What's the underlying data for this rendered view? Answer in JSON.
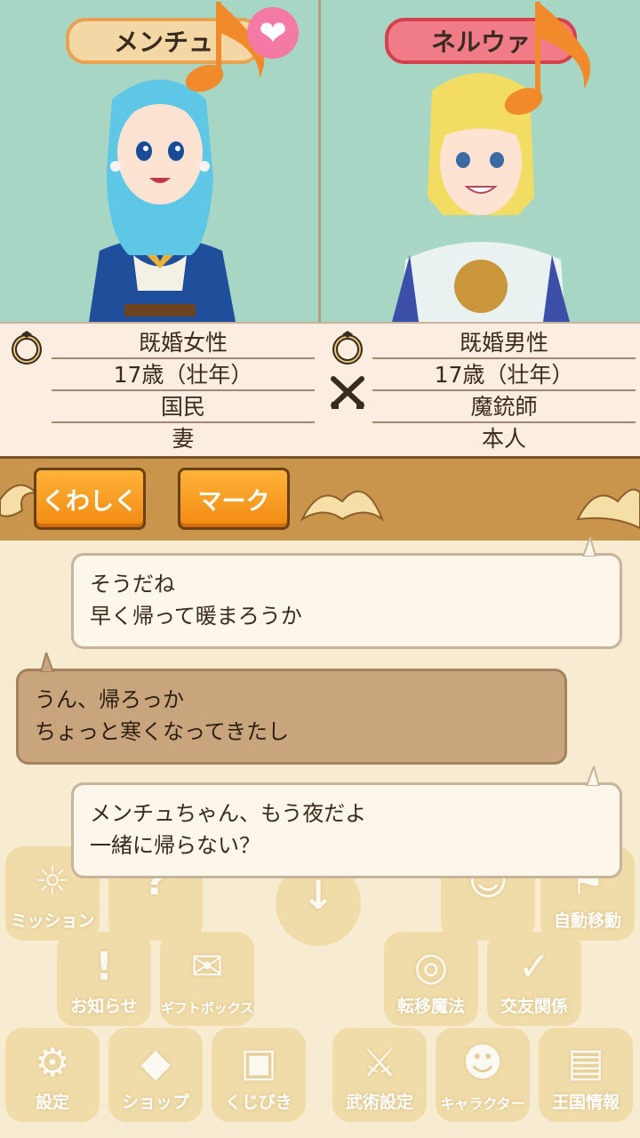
{
  "left_character": {
    "name": "メンチュ",
    "status": "既婚女性",
    "age": "17歳（壮年）",
    "occupation": "国民",
    "role": "妻",
    "hair_color": "#5fc7e6",
    "outfit_color": "#1f4f9b"
  },
  "right_character": {
    "name": "ネルウァ",
    "status": "既婚男性",
    "age": "17歳（壮年）",
    "occupation": "魔銃師",
    "role": "本人",
    "hair_color": "#f2dc62",
    "outfit_color": "#e9f2f1"
  },
  "icons": {
    "left_status": "ring-icon",
    "right_status": "ring-icon",
    "right_job": "crossed-guns-icon",
    "heart": "heart-icon",
    "note": "music-note-icon"
  },
  "toolbar": {
    "detail_label": "くわしく",
    "mark_label": "マーク"
  },
  "dialogue": [
    {
      "speaker": "right",
      "line1": "そうだね",
      "line2": "早く帰って暖まろうか"
    },
    {
      "speaker": "left",
      "line1": "うん、帰ろっか",
      "line2": "ちょっと寒くなってきたし"
    },
    {
      "speaker": "right",
      "line1": "メンチュちゃん、もう夜だよ",
      "line2": "一緒に帰らない？"
    }
  ],
  "menu": {
    "mission": "ミッション",
    "auto_move": "自動移動",
    "news": "お知らせ",
    "giftbox": "ギフトボックス",
    "teleport": "転移魔法",
    "friends": "交友関係",
    "settings": "設定",
    "shop": "ショップ",
    "lottery": "くじびき",
    "martial": "武術設定",
    "character": "キャラクター",
    "kingdom": "王国情報"
  },
  "colors": {
    "portrait_bg": "#a8d6c4",
    "info_bg": "#fbeee1",
    "toolbar_bg": "#c9954c",
    "button": "#f59a1e",
    "name_tag_left": "#f3d7a4",
    "name_tag_right": "#ef7c87"
  }
}
